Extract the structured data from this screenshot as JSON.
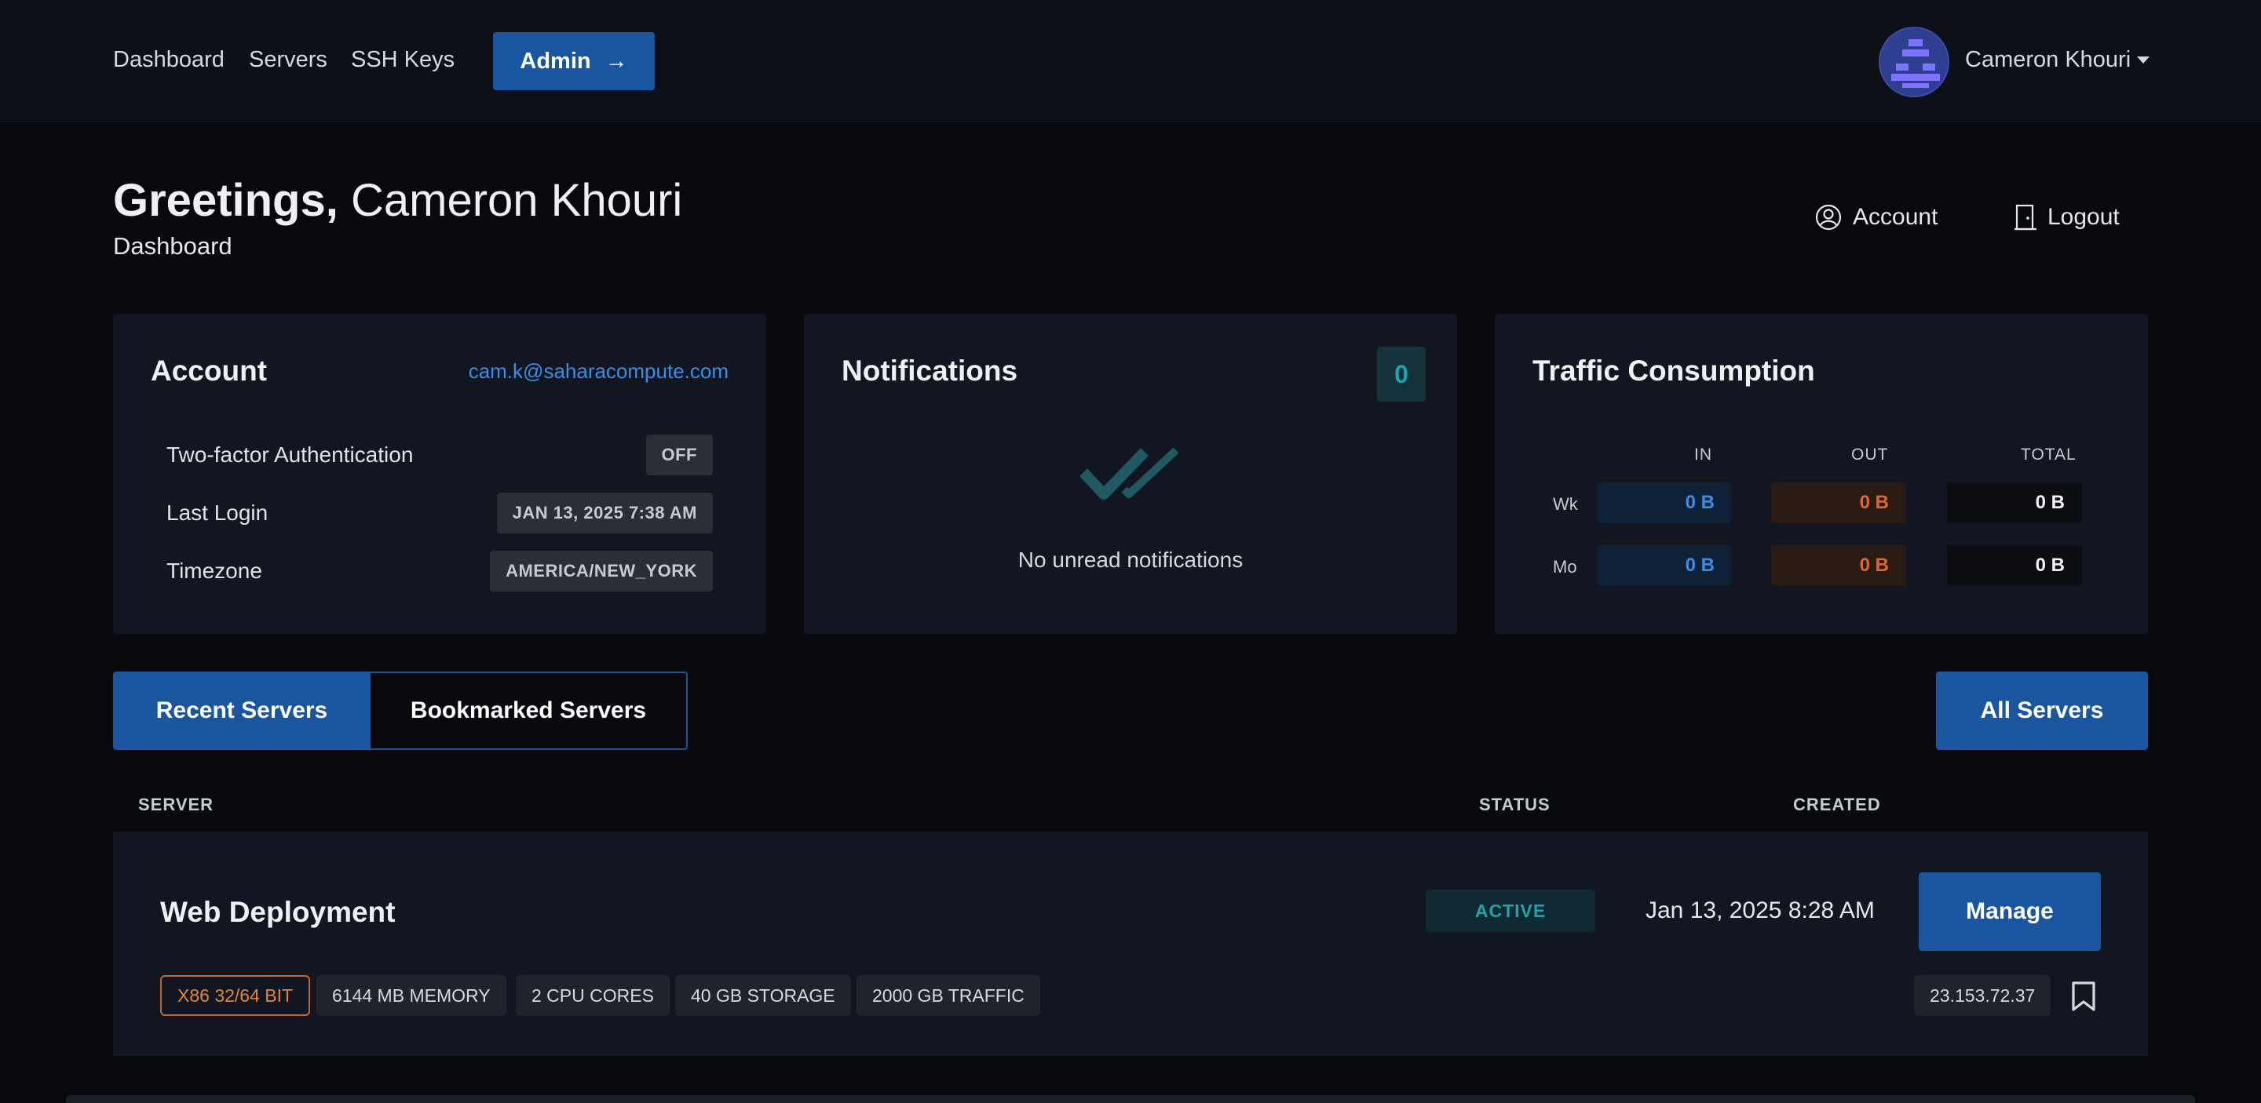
{
  "nav": {
    "links": [
      "Dashboard",
      "Servers",
      "SSH Keys"
    ],
    "admin_label": "Admin",
    "admin_arrow": "→",
    "user_name": "Cameron Khouri"
  },
  "header": {
    "greeting_bold": "Greetings,",
    "greeting_name": "Cameron Khouri",
    "subtitle": "Dashboard",
    "account_label": "Account",
    "logout_label": "Logout"
  },
  "account_card": {
    "title": "Account",
    "email": "cam.k@saharacompute.com",
    "rows": [
      {
        "label": "Two-factor Authentication",
        "value": "OFF"
      },
      {
        "label": "Last Login",
        "value": "JAN 13, 2025 7:38 AM"
      },
      {
        "label": "Timezone",
        "value": "AMERICA/NEW_YORK"
      }
    ]
  },
  "notifications_card": {
    "title": "Notifications",
    "count": "0",
    "empty_text": "No unread notifications"
  },
  "traffic_card": {
    "title": "Traffic Consumption",
    "columns": [
      "IN",
      "OUT",
      "TOTAL"
    ],
    "rows": [
      {
        "label": "Wk",
        "in": "0 B",
        "out": "0 B",
        "total": "0 B"
      },
      {
        "label": "Mo",
        "in": "0 B",
        "out": "0 B",
        "total": "0 B"
      }
    ]
  },
  "tabs": {
    "recent": "Recent Servers",
    "bookmarked": "Bookmarked Servers",
    "all_servers": "All Servers"
  },
  "table": {
    "headers": [
      "SERVER",
      "STATUS",
      "CREATED"
    ]
  },
  "server": {
    "name": "Web Deployment",
    "status": "ACTIVE",
    "created": "Jan 13, 2025 8:28 AM",
    "manage_label": "Manage",
    "specs": [
      "X86 32/64 BIT",
      "6144 MB MEMORY",
      "2 CPU CORES",
      "40 GB STORAGE",
      "2000 GB TRAFFIC"
    ],
    "ip": "23.153.72.37"
  },
  "colors": {
    "accent": "#1a56a0",
    "link": "#3a8ee6",
    "status_active": "#23a1b0",
    "traffic_out": "#e0662f"
  }
}
